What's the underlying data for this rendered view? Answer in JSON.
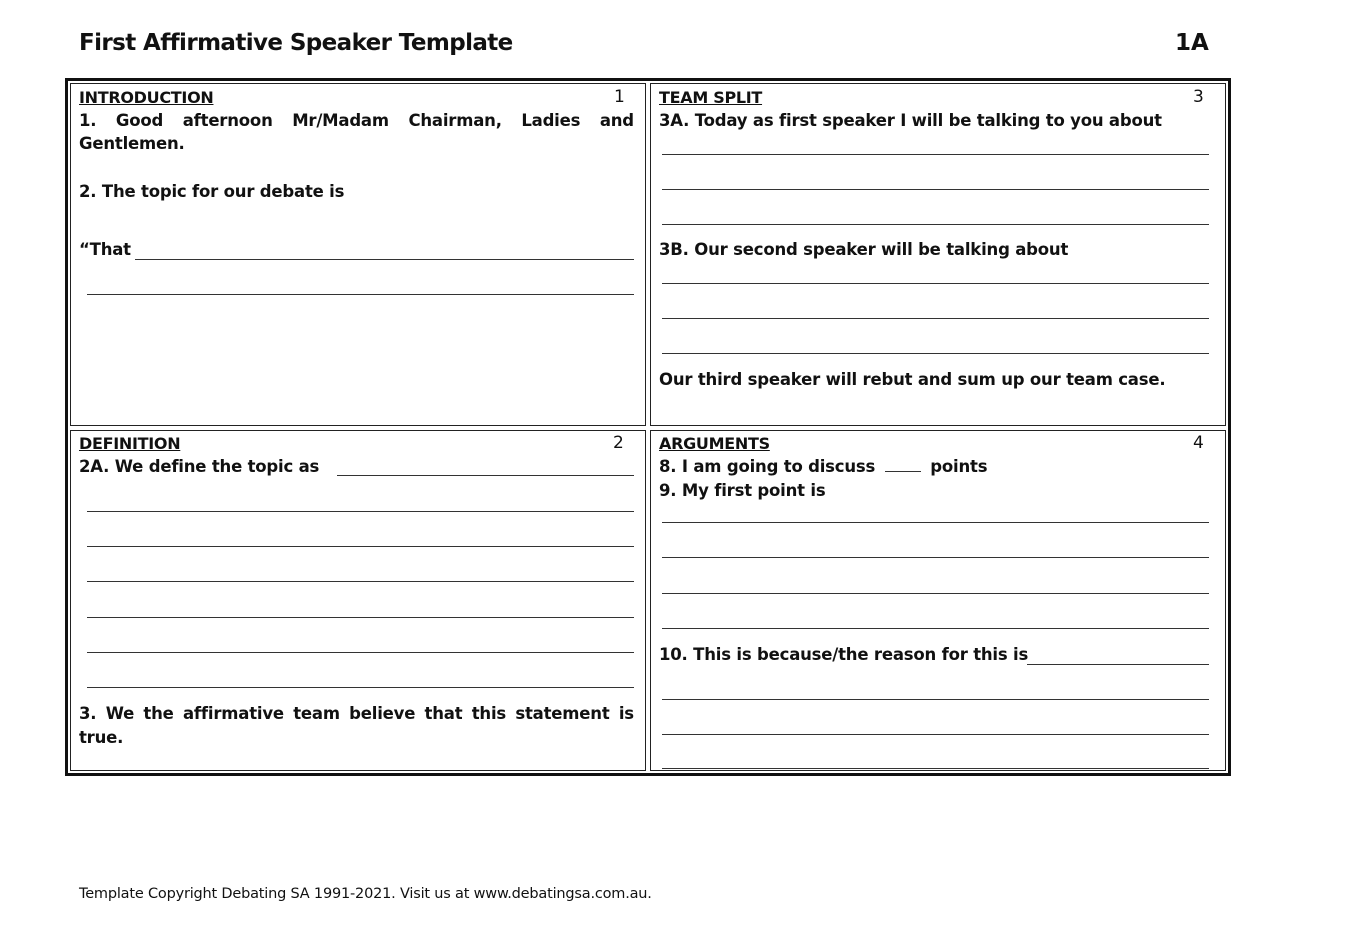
{
  "header": {
    "title": "First Affirmative Speaker Template",
    "page_code": "1A"
  },
  "sections": {
    "introduction": {
      "heading": "INTRODUCTION",
      "number": "1",
      "line1_words": [
        "1.",
        "Good",
        "afternoon",
        "Mr/Madam",
        "Chairman,",
        "Ladies",
        "and"
      ],
      "line1b": "Gentlemen.",
      "topic_prompt": "2. The topic for our debate is",
      "that_prefix": "“That"
    },
    "definition": {
      "heading": "DEFINITION",
      "number": "2",
      "define_prompt": "2A. We define the topic as",
      "belief_words": [
        "3.",
        "We",
        "the",
        "affirmative",
        "team",
        "believe",
        "that",
        "this",
        "statement",
        "is"
      ],
      "belief_line2": "true."
    },
    "team_split": {
      "heading": "TEAM SPLIT",
      "number": "3",
      "first_speaker_prompt": "3A. Today as first speaker I will be talking to you about",
      "second_speaker_prompt": "3B. Our second speaker will be talking about",
      "third_speaker_statement": "Our third speaker will rebut and sum up our team case."
    },
    "arguments": {
      "heading": "ARGUMENTS",
      "number": "4",
      "points_prefix": "8. I am going to discuss",
      "points_suffix": "points",
      "first_point_prompt": "9. My first point is",
      "reason_prompt": "10. This is because/the reason for this is"
    }
  },
  "footer": {
    "copyright": "Template Copyright Debating SA 1991-2021. Visit us at www.debatingsa.com.au."
  }
}
